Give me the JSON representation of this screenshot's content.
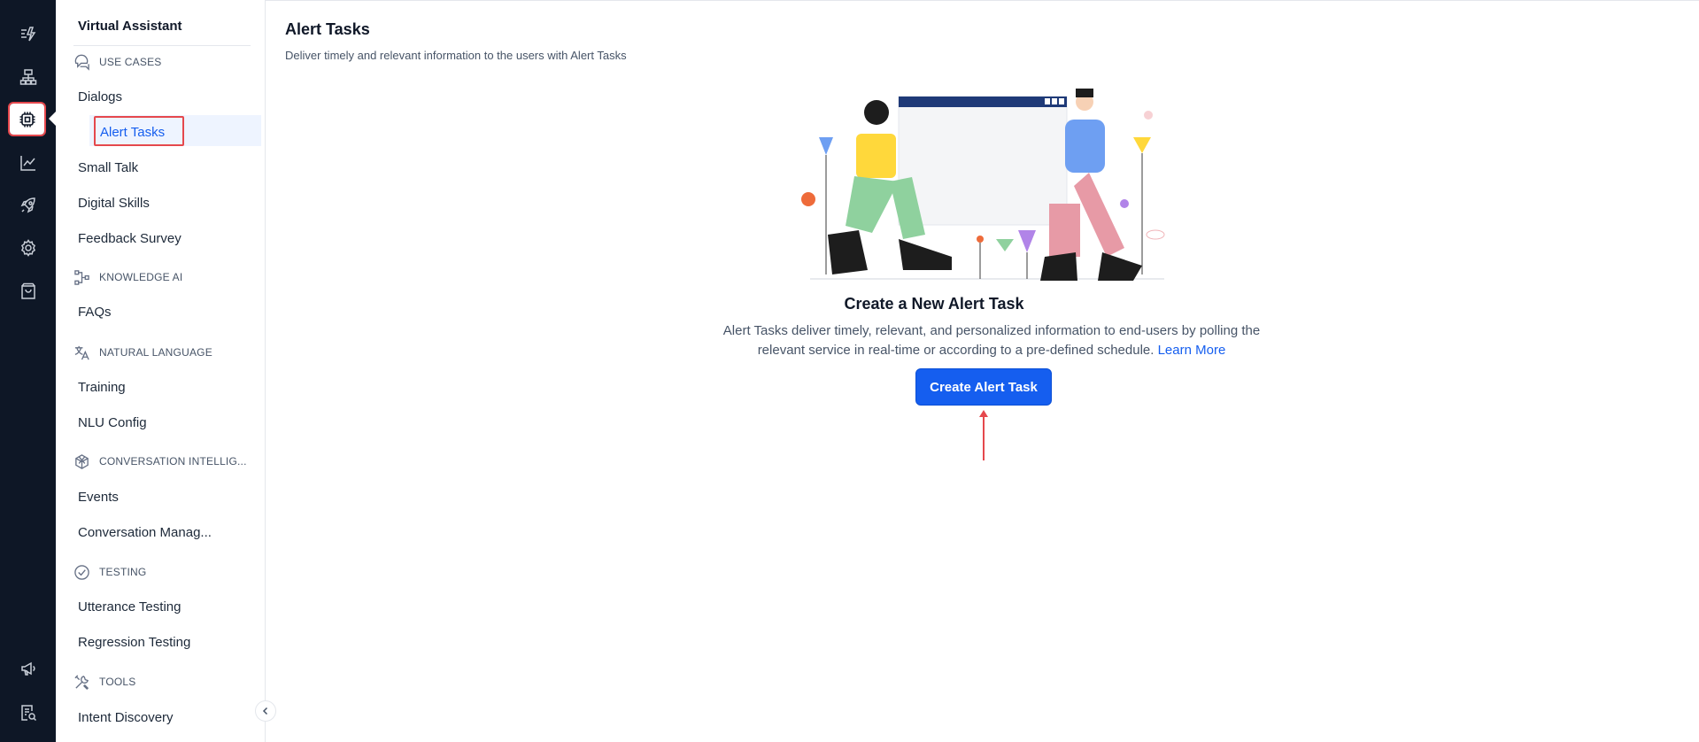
{
  "sidebar": {
    "title": "Virtual Assistant",
    "sections": [
      {
        "label": "USE CASES",
        "icon": "chat-bubbles-icon"
      },
      {
        "label": "KNOWLEDGE AI",
        "icon": "knowledge-graph-icon"
      },
      {
        "label": "NATURAL LANGUAGE",
        "icon": "translate-icon"
      },
      {
        "label": "CONVERSATION INTELLIG...",
        "icon": "cube-icon"
      },
      {
        "label": "TESTING",
        "icon": "check-circle-icon"
      },
      {
        "label": "TOOLS",
        "icon": "tools-icon"
      }
    ],
    "items": {
      "dialogs": "Dialogs",
      "alert_tasks": "Alert Tasks",
      "small_talk": "Small Talk",
      "digital_skills": "Digital Skills",
      "feedback_survey": "Feedback Survey",
      "faqs": "FAQs",
      "training": "Training",
      "nlu_config": "NLU Config",
      "events": "Events",
      "conversation_manag": "Conversation Manag...",
      "utterance_testing": "Utterance Testing",
      "regression_testing": "Regression Testing",
      "intent_discovery": "Intent Discovery"
    },
    "active_item": "Alert Tasks"
  },
  "rail": {
    "icons": [
      "automation-icon",
      "sitemap-icon",
      "bot-chip-icon",
      "analytics-chart-icon",
      "rocket-icon",
      "settings-gear-icon",
      "store-bag-icon",
      "announcement-icon",
      "search-document-icon"
    ],
    "active": "bot-chip-icon"
  },
  "main": {
    "title": "Alert Tasks",
    "subtitle": "Deliver timely and relevant information to the users with Alert Tasks",
    "empty_state": {
      "title": "Create a New Alert Task",
      "description_line1": "Alert Tasks deliver timely, relevant, and personalized information to end-users by polling the",
      "description_line2": "relevant service in real-time or according to a pre-defined schedule.",
      "learn_more": "Learn More",
      "button_label": "Create Alert Task"
    }
  },
  "colors": {
    "rail_bg": "#0e1726",
    "primary": "#155eef",
    "highlight_border": "#e5484d",
    "selected_bg": "#eef4ff"
  }
}
